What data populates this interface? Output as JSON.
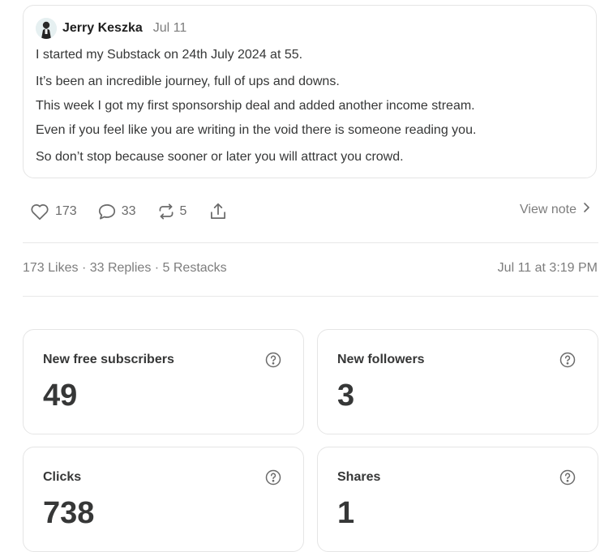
{
  "note": {
    "author": "Jerry Keszka",
    "date": "Jul 11",
    "lines": [
      "I started my Substack on 24th July 2024 at 55.",
      "It’s been an incredible journey, full of ups and downs.",
      "This week I got my first sponsorship deal and added another income stream.",
      "Even if you feel like you are writing in the void there is someone reading you.",
      "So don’t stop because sooner or later you will attract you crowd."
    ]
  },
  "actions": {
    "likes": "173",
    "replies": "33",
    "restacks": "5",
    "view_note": "View note"
  },
  "stats": {
    "summary": "173 Likes · 33 Replies · 5 Restacks",
    "timestamp": "Jul 11 at 3:19 PM"
  },
  "metrics": [
    {
      "label": "New free subscribers",
      "value": "49"
    },
    {
      "label": "New followers",
      "value": "3"
    },
    {
      "label": "Clicks",
      "value": "738"
    },
    {
      "label": "Shares",
      "value": "1"
    }
  ],
  "icons": {
    "like": "heart-icon",
    "reply": "comment-icon",
    "restack": "restack-icon",
    "share": "share-icon",
    "chevron": "chevron-right-icon",
    "help": "question-circle-icon"
  }
}
